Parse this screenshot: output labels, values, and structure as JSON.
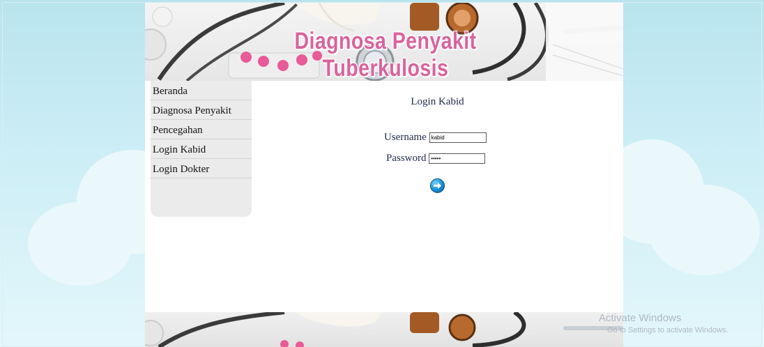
{
  "header": {
    "site_title": "Diagnosa Penyakit Tuberkulosis"
  },
  "sidebar": {
    "items": [
      {
        "label": "Beranda"
      },
      {
        "label": "Diagnosa Penyakit"
      },
      {
        "label": "Pencegahan"
      },
      {
        "label": "Login Kabid"
      },
      {
        "label": "Login Dokter"
      }
    ]
  },
  "login": {
    "title": "Login Kabid",
    "username_label": "Username",
    "username_value": "kabid",
    "password_label": "Password",
    "password_value": "•••••",
    "submit_icon": "arrow-right-circle-icon"
  },
  "watermark": {
    "line1": "Activate Windows",
    "line2": "Go to Settings to activate Windows."
  },
  "colors": {
    "title_pink": "#d9639d",
    "text_navy": "#1e2a4a",
    "sidebar_bg": "#ebebeb",
    "page_bg": "#b9e4ee",
    "button_blue": "#1b8fd2"
  }
}
